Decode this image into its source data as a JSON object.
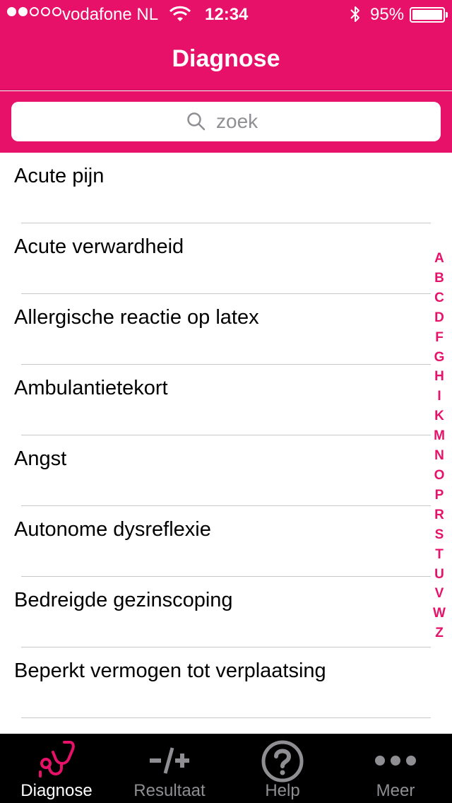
{
  "status_bar": {
    "carrier": "vodafone NL",
    "time": "12:34",
    "battery": "95%",
    "battery_level": 0.95,
    "signal_bars_filled": 2,
    "signal_bars_total": 5
  },
  "nav": {
    "title": "Diagnose"
  },
  "search": {
    "placeholder": "zoek",
    "value": ""
  },
  "list": {
    "items": [
      {
        "label": "Acute pijn"
      },
      {
        "label": "Acute verwardheid"
      },
      {
        "label": "Allergische reactie op latex"
      },
      {
        "label": "Ambulantietekort"
      },
      {
        "label": "Angst"
      },
      {
        "label": "Autonome dysreflexie"
      },
      {
        "label": "Bedreigde gezinscoping"
      },
      {
        "label": "Beperkt vermogen tot verplaatsing"
      }
    ]
  },
  "index": {
    "letters": [
      "A",
      "B",
      "C",
      "D",
      "F",
      "G",
      "H",
      "I",
      "K",
      "M",
      "N",
      "O",
      "P",
      "R",
      "S",
      "T",
      "U",
      "V",
      "W",
      "Z"
    ]
  },
  "tabs": [
    {
      "label": "Diagnose",
      "icon": "stethoscope-icon",
      "active": true
    },
    {
      "label": "Resultaat",
      "icon": "minus-plus-icon",
      "active": false
    },
    {
      "label": "Help",
      "icon": "question-circle-icon",
      "active": false
    },
    {
      "label": "Meer",
      "icon": "more-dots-icon",
      "active": false
    }
  ],
  "colors": {
    "brand": "#e8116a",
    "tab_bar": "#000000",
    "inactive_tab": "#8e8e93"
  }
}
